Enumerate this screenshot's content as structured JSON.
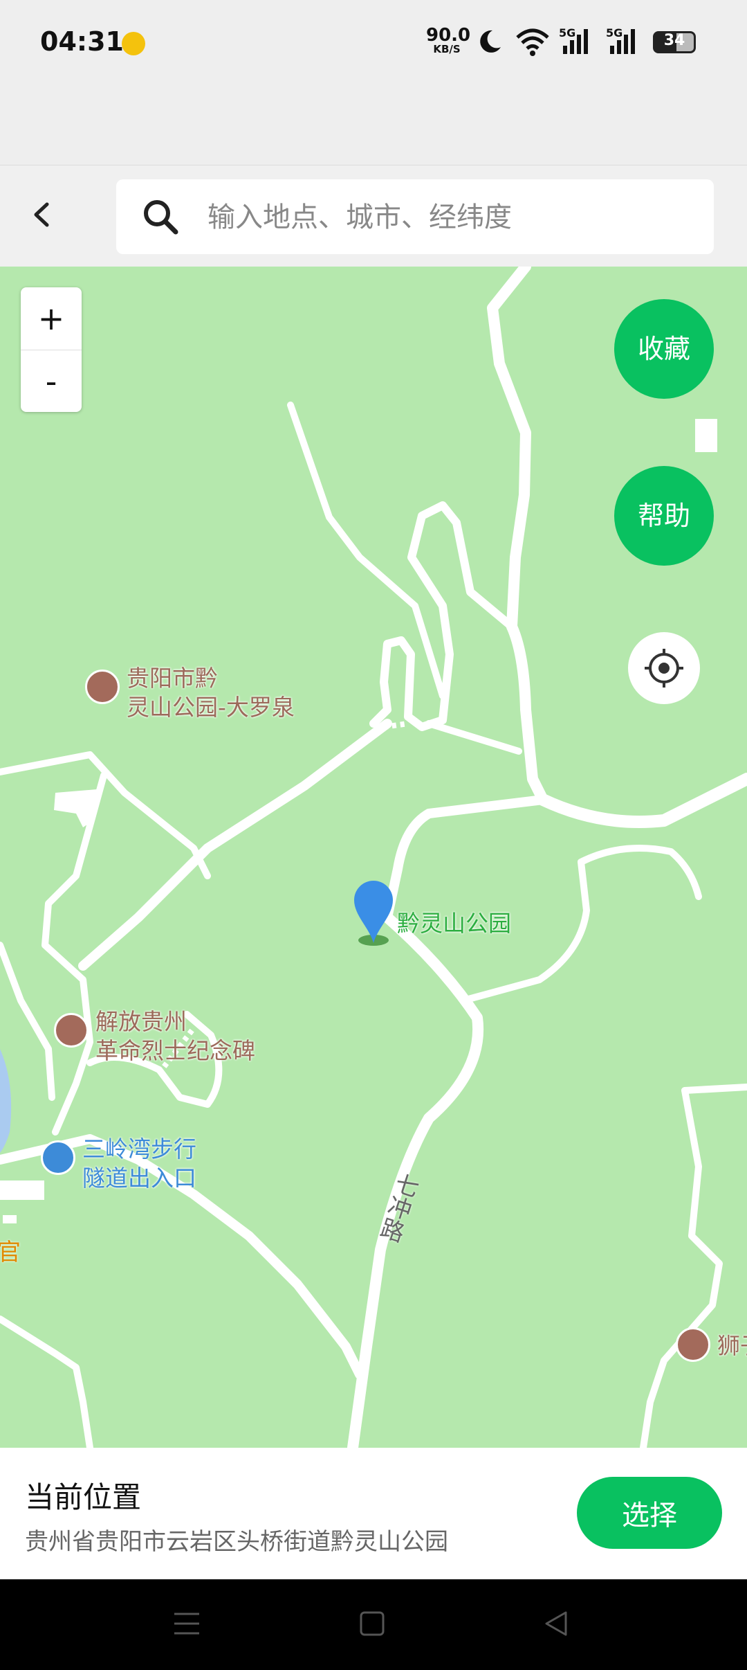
{
  "status_bar": {
    "time": "04:31",
    "net_speed_value": "90.0",
    "net_speed_unit": "KB/S",
    "network_label_1": "5G",
    "network_label_2": "5G",
    "battery": "34"
  },
  "search": {
    "placeholder": "输入地点、城市、经纬度"
  },
  "map": {
    "zoom_in": "+",
    "zoom_out": "-",
    "favorite_label": "收藏",
    "help_label": "帮助",
    "pois": [
      {
        "line1": "贵阳市黔",
        "line2": "灵山公园-大罗泉"
      },
      {
        "line1": "解放贵州",
        "line2": "革命烈士纪念碑"
      },
      {
        "line1": "三岭湾步行",
        "line2": "隧道出入口"
      },
      {
        "line1": "狮子"
      }
    ],
    "selected_place": "黔灵山公园",
    "road_name": "七冲路",
    "edge_label": "官"
  },
  "current_location": {
    "title": "当前位置",
    "address": "贵州省贵阳市云岩区头桥街道黔灵山公园",
    "select_label": "选择"
  },
  "colors": {
    "accent": "#09c160",
    "map_green": "#b5e8ad",
    "poi_brown": "#9c6a5a",
    "poi_blue": "#3d8bd8"
  }
}
